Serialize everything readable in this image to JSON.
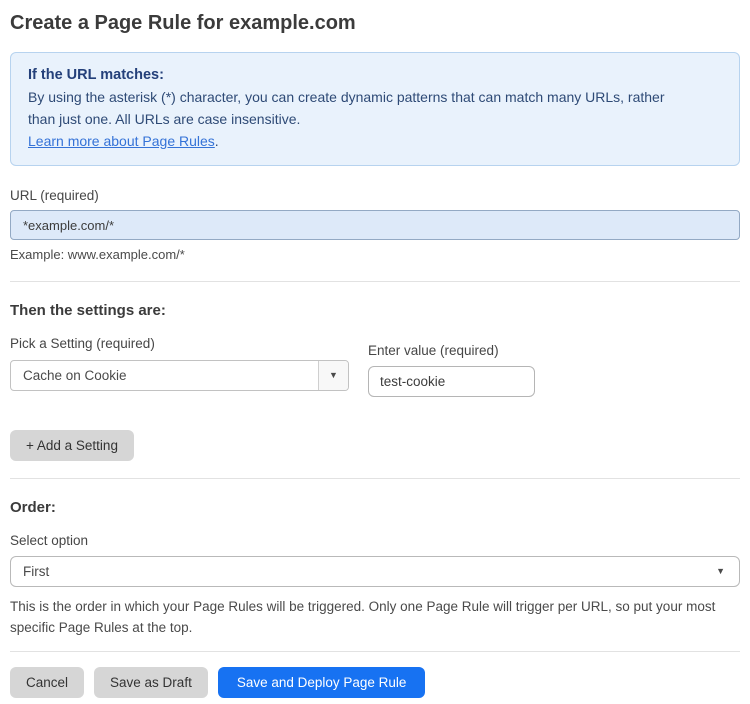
{
  "page": {
    "title": "Create a Page Rule for example.com"
  },
  "info_box": {
    "heading": "If the URL matches:",
    "body": "By using the asterisk (*) character, you can create dynamic patterns that can match many URLs, rather than just one. All URLs are case insensitive.",
    "link_label": "Learn more about Page Rules",
    "link_suffix": "."
  },
  "url_field": {
    "label": "URL (required)",
    "value": "*example.com/*",
    "example": "Example: www.example.com/*"
  },
  "settings_section": {
    "heading": "Then the settings are:",
    "setting_select": {
      "label": "Pick a Setting (required)",
      "selected": "Cache on Cookie"
    },
    "value_field": {
      "label": "Enter value (required)",
      "value": "test-cookie"
    },
    "add_setting_label": "+ Add a Setting"
  },
  "order_section": {
    "heading": "Order:",
    "select_label": "Select option",
    "selected": "First",
    "help_text": "This is the order in which your Page Rules will be triggered. Only one Page Rule will trigger per URL, so put your most specific Page Rules at the top."
  },
  "actions": {
    "cancel_label": "Cancel",
    "save_draft_label": "Save as Draft",
    "save_deploy_label": "Save and Deploy Page Rule"
  },
  "icons": {
    "caret_down": "▼"
  },
  "colors": {
    "accent_blue": "#1772f2",
    "info_box_bg": "#e9f2fc",
    "info_box_border": "#b7d3ef",
    "info_text": "#2e4a76",
    "link_blue": "#3472d7",
    "url_input_bg": "#dde9f9",
    "gray_button_bg": "#d6d6d6"
  }
}
